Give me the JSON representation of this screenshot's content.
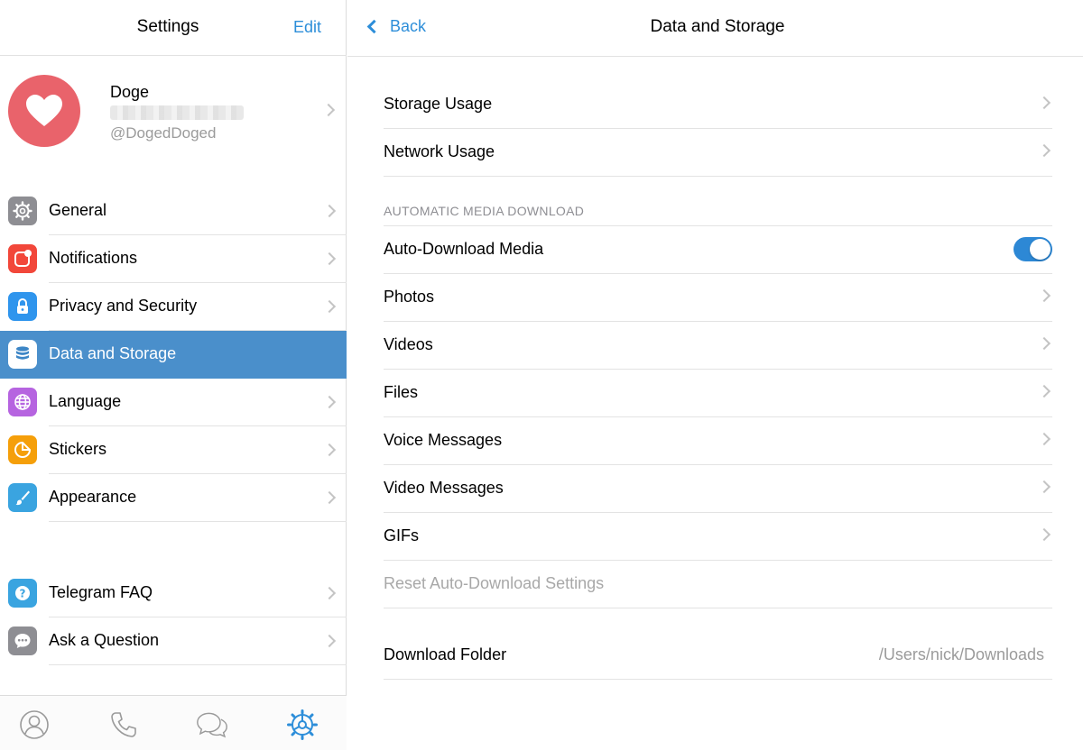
{
  "left": {
    "title": "Settings",
    "edit_label": "Edit",
    "profile": {
      "name": "Doge",
      "username": "@DogedDoged",
      "avatar_color": "#e9636b"
    },
    "menu_group1": [
      {
        "label": "General",
        "icon": "gear-icon",
        "color": "#8e8e93"
      },
      {
        "label": "Notifications",
        "icon": "notification-icon",
        "color": "#f2473a"
      },
      {
        "label": "Privacy and Security",
        "icon": "lock-icon",
        "color": "#2f95ed"
      },
      {
        "label": "Data and Storage",
        "icon": "database-icon",
        "color": "#3fae5a",
        "active": true
      },
      {
        "label": "Language",
        "icon": "globe-icon",
        "color": "#b664e0"
      },
      {
        "label": "Stickers",
        "icon": "sticker-icon",
        "color": "#f59f0a"
      },
      {
        "label": "Appearance",
        "icon": "brush-icon",
        "color": "#3aa4e0"
      }
    ],
    "menu_group2": [
      {
        "label": "Telegram FAQ",
        "icon": "question-icon",
        "color": "#3aa4e0"
      },
      {
        "label": "Ask a Question",
        "icon": "chat-bubble-icon",
        "color": "#8e8e93"
      }
    ],
    "tabs": [
      "contacts-icon",
      "calls-icon",
      "chats-icon",
      "settings-icon"
    ]
  },
  "right": {
    "back_label": "Back",
    "title": "Data and Storage",
    "usage": [
      "Storage Usage",
      "Network Usage"
    ],
    "section_header": "AUTOMATIC MEDIA DOWNLOAD",
    "auto_download": {
      "label": "Auto-Download Media",
      "enabled": true
    },
    "media_types": [
      "Photos",
      "Videos",
      "Files",
      "Voice Messages",
      "Video Messages",
      "GIFs"
    ],
    "reset_label": "Reset Auto-Download Settings",
    "download_folder": {
      "label": "Download Folder",
      "value": "/Users/nick/Downloads"
    },
    "accent": "#2d8ed9"
  }
}
